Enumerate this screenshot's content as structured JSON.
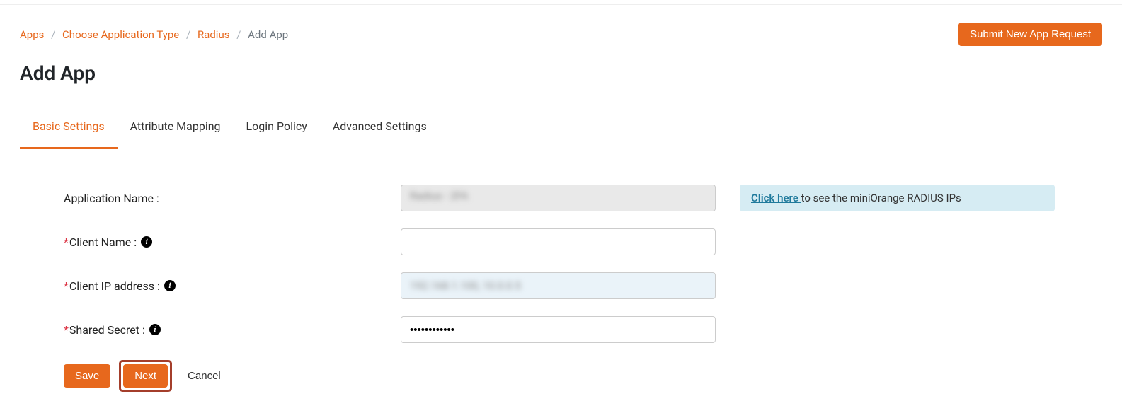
{
  "breadcrumb": {
    "apps": "Apps",
    "choose_type": "Choose Application Type",
    "radius": "Radius",
    "add_app": "Add App"
  },
  "header": {
    "submit_request": "Submit New App Request"
  },
  "page": {
    "title": "Add App"
  },
  "tabs": {
    "basic": "Basic Settings",
    "attribute": "Attribute Mapping",
    "login": "Login Policy",
    "advanced": "Advanced Settings"
  },
  "form": {
    "app_name_label": "Application Name :",
    "app_name_value": "Radius  - 2FA",
    "client_name_label": "Client Name :",
    "client_name_value": "",
    "client_ip_label": "Client IP address :",
    "client_ip_value": "192.168.1.100, 10.0.0.5",
    "shared_secret_label": "Shared Secret :",
    "shared_secret_value": "••••••••••••"
  },
  "info": {
    "click_here": "Click here ",
    "rest": "to see the miniOrange RADIUS IPs"
  },
  "actions": {
    "save": "Save",
    "next": "Next",
    "cancel": "Cancel"
  }
}
